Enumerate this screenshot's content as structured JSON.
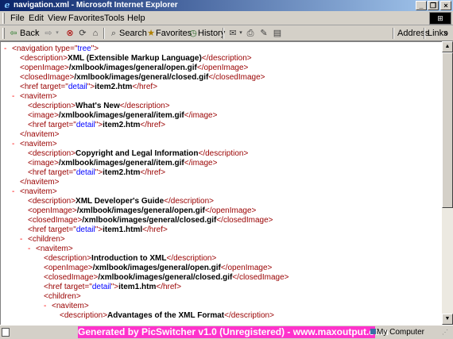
{
  "window": {
    "title": "navigation.xml - Microsoft Internet Explorer",
    "minimize_glyph": "_",
    "maximize_glyph": "❐",
    "close_glyph": "×"
  },
  "menubar": {
    "items": [
      "File",
      "Edit",
      "View",
      "Favorites",
      "Tools",
      "Help"
    ]
  },
  "toolbar": {
    "back_label": "Back",
    "forward_glyph": "⇨",
    "search_label": "Search",
    "favorites_label": "Favorites",
    "history_label": "History",
    "address_label": "Address",
    "links_label": "Links",
    "links_chevron": "»"
  },
  "xml_lines": [
    {
      "minus": "-",
      "parts": [
        [
          "t",
          "<navigation "
        ],
        [
          "t",
          "type=\""
        ],
        [
          "av",
          "tree"
        ],
        [
          "t",
          "\">"
        ]
      ]
    },
    {
      "minus": "",
      "parts": [
        [
          "t",
          "<description>"
        ],
        [
          "tx",
          "XML (Extensible Markup Language)"
        ],
        [
          "t",
          "</description>"
        ]
      ]
    },
    {
      "minus": "",
      "parts": [
        [
          "t",
          "<openImage>"
        ],
        [
          "tx",
          "/xmlbook/images/general/open.gif"
        ],
        [
          "t",
          "</openImage>"
        ]
      ]
    },
    {
      "minus": "",
      "parts": [
        [
          "t",
          "<closedImage>"
        ],
        [
          "tx",
          "/xmlbook/images/general/closed.gif"
        ],
        [
          "t",
          "</closedImage>"
        ]
      ]
    },
    {
      "minus": "",
      "parts": [
        [
          "t",
          "<href "
        ],
        [
          "t",
          "target=\""
        ],
        [
          "av",
          "detail"
        ],
        [
          "t",
          "\">"
        ],
        [
          "tx",
          "item2.htm"
        ],
        [
          "t",
          "</href>"
        ]
      ]
    },
    {
      "minus": "-",
      "parts": [
        [
          "t",
          "<navitem>"
        ]
      ]
    },
    {
      "minus": "",
      "parts": [
        [
          "t",
          "<description>"
        ],
        [
          "tx",
          "What's New"
        ],
        [
          "t",
          "</description>"
        ]
      ]
    },
    {
      "minus": "",
      "parts": [
        [
          "t",
          "<image>"
        ],
        [
          "tx",
          "/xmlbook/images/general/item.gif"
        ],
        [
          "t",
          "</image>"
        ]
      ]
    },
    {
      "minus": "",
      "parts": [
        [
          "t",
          "<href "
        ],
        [
          "t",
          "target=\""
        ],
        [
          "av",
          "detail"
        ],
        [
          "t",
          "\">"
        ],
        [
          "tx",
          "item2.htm"
        ],
        [
          "t",
          "</href>"
        ]
      ]
    },
    {
      "minus": "",
      "parts": [
        [
          "t",
          "</navitem>"
        ]
      ]
    },
    {
      "minus": "-",
      "parts": [
        [
          "t",
          "<navitem>"
        ]
      ]
    },
    {
      "minus": "",
      "parts": [
        [
          "t",
          "<description>"
        ],
        [
          "tx",
          "Copyright and Legal Information"
        ],
        [
          "t",
          "</description>"
        ]
      ]
    },
    {
      "minus": "",
      "parts": [
        [
          "t",
          "<image>"
        ],
        [
          "tx",
          "/xmlbook/images/general/item.gif"
        ],
        [
          "t",
          "</image>"
        ]
      ]
    },
    {
      "minus": "",
      "parts": [
        [
          "t",
          "<href "
        ],
        [
          "t",
          "target=\""
        ],
        [
          "av",
          "detail"
        ],
        [
          "t",
          "\">"
        ],
        [
          "tx",
          "item2.htm"
        ],
        [
          "t",
          "</href>"
        ]
      ]
    },
    {
      "minus": "",
      "parts": [
        [
          "t",
          "</navitem>"
        ]
      ]
    },
    {
      "minus": "-",
      "parts": [
        [
          "t",
          "<navitem>"
        ]
      ]
    },
    {
      "minus": "",
      "parts": [
        [
          "t",
          "<description>"
        ],
        [
          "tx",
          "XML Developer's Guide"
        ],
        [
          "t",
          "</description>"
        ]
      ]
    },
    {
      "minus": "",
      "parts": [
        [
          "t",
          "<openImage>"
        ],
        [
          "tx",
          "/xmlbook/images/general/open.gif"
        ],
        [
          "t",
          "</openImage>"
        ]
      ]
    },
    {
      "minus": "",
      "parts": [
        [
          "t",
          "<closedImage>"
        ],
        [
          "tx",
          "/xmlbook/images/general/closed.gif"
        ],
        [
          "t",
          "</closedImage>"
        ]
      ]
    },
    {
      "minus": "",
      "parts": [
        [
          "t",
          "<href "
        ],
        [
          "t",
          "target=\""
        ],
        [
          "av",
          "detail"
        ],
        [
          "t",
          "\">"
        ],
        [
          "tx",
          "item1.html"
        ],
        [
          "t",
          "</href>"
        ]
      ]
    },
    {
      "minus": "-",
      "parts": [
        [
          "t",
          "<children>"
        ]
      ]
    },
    {
      "minus": "-",
      "parts": [
        [
          "t",
          "<navitem>"
        ]
      ]
    },
    {
      "minus": "",
      "parts": [
        [
          "t",
          "<description>"
        ],
        [
          "tx",
          "Introduction to XML"
        ],
        [
          "t",
          "</description>"
        ]
      ]
    },
    {
      "minus": "",
      "parts": [
        [
          "t",
          "<openImage>"
        ],
        [
          "tx",
          "/xmlbook/images/general/open.gif"
        ],
        [
          "t",
          "</openImage>"
        ]
      ]
    },
    {
      "minus": "",
      "parts": [
        [
          "t",
          "<closedImage>"
        ],
        [
          "tx",
          "/xmlbook/images/general/closed.gif"
        ],
        [
          "t",
          "</closedImage>"
        ]
      ]
    },
    {
      "minus": "",
      "parts": [
        [
          "t",
          "<href "
        ],
        [
          "t",
          "target=\""
        ],
        [
          "av",
          "detail"
        ],
        [
          "t",
          "\">"
        ],
        [
          "tx",
          "item1.htm"
        ],
        [
          "t",
          "</href>"
        ]
      ]
    },
    {
      "minus": "",
      "parts": [
        [
          "t",
          "<children>"
        ]
      ]
    },
    {
      "minus": "-",
      "parts": [
        [
          "t",
          "<navitem>"
        ]
      ]
    },
    {
      "minus": "",
      "parts": [
        [
          "t",
          "<description>"
        ],
        [
          "tx",
          "Advantages of the XML Format"
        ],
        [
          "t",
          "</description>"
        ]
      ]
    }
  ],
  "scrollbar": {
    "up_glyph": "▲",
    "down_glyph": "▼"
  },
  "statusbar": {
    "banner": "Generated by PicSwitcher v1.0 (Unregistered) - www.maxoutput.com",
    "zone": "My Computer"
  },
  "colors": {
    "tag": "#990000",
    "attr_value": "#0000ff",
    "minus": "#ff0000",
    "banner": "#ff33cc"
  }
}
